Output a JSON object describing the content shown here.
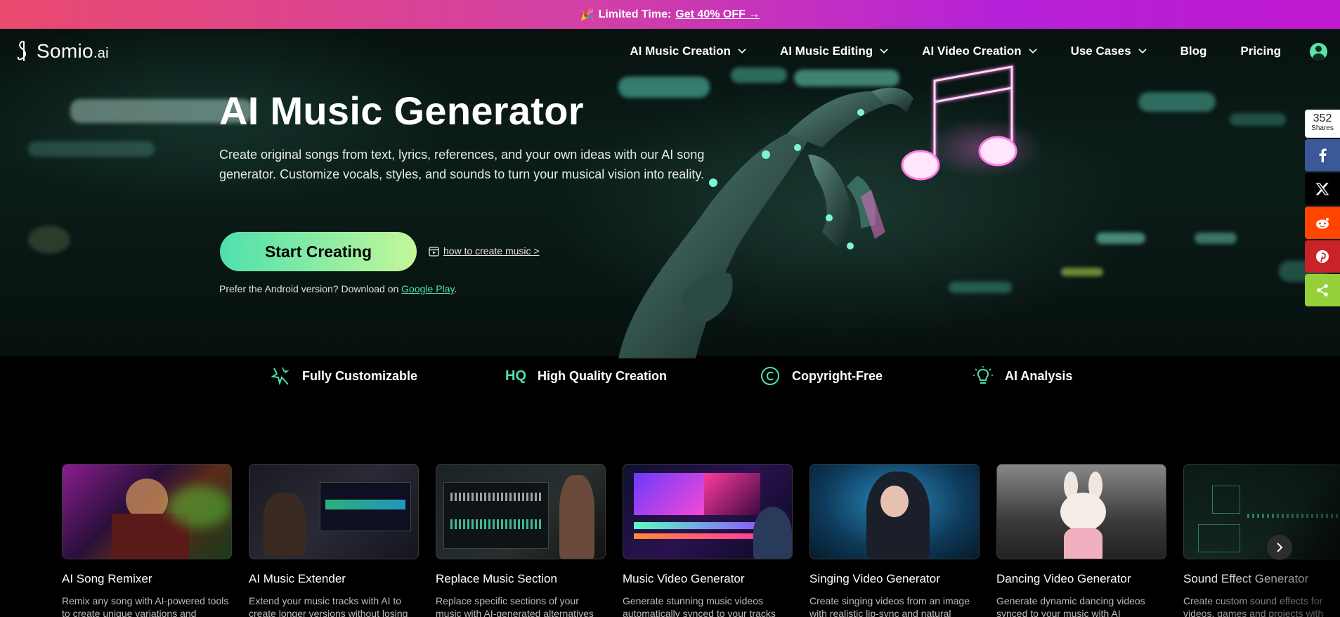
{
  "promo": {
    "prefix": "Limited Time:",
    "link": "Get 40% OFF →"
  },
  "brand": {
    "name": "Somio",
    "suffix": ".ai"
  },
  "nav": {
    "items": [
      {
        "label": "AI Music Creation",
        "has_dropdown": true
      },
      {
        "label": "AI Music Editing",
        "has_dropdown": true
      },
      {
        "label": "AI Video Creation",
        "has_dropdown": true
      },
      {
        "label": "Use Cases",
        "has_dropdown": true
      },
      {
        "label": "Blog",
        "has_dropdown": false
      },
      {
        "label": "Pricing",
        "has_dropdown": false
      }
    ],
    "avatar_icon": "user-avatar-icon"
  },
  "hero": {
    "title": "AI Music Generator",
    "description": "Create original songs from text, lyrics, references, and your own ideas with our AI song generator. Customize vocals, styles, and sounds to turn your musical vision into reality.",
    "cta_label": "Start Creating",
    "howto_label": "how to create music >",
    "android_prefix": "Prefer the Android version? Download on ",
    "android_link": "Google Play",
    "android_suffix": "."
  },
  "features": [
    {
      "label": "Fully Customizable",
      "icon": "magic-wand-icon"
    },
    {
      "label": "High Quality Creation",
      "icon": "hq-icon",
      "icon_text": "HQ"
    },
    {
      "label": "Copyright-Free",
      "icon": "copyright-icon"
    },
    {
      "label": "AI Analysis",
      "icon": "lightbulb-icon"
    }
  ],
  "cards": [
    {
      "title": "AI Song Remixer",
      "desc": "Remix any song with AI-powered tools to create unique variations and"
    },
    {
      "title": "AI Music Extender",
      "desc": "Extend your music tracks with AI to create longer versions without losing"
    },
    {
      "title": "Replace Music Section",
      "desc": "Replace specific sections of your music with AI-generated alternatives"
    },
    {
      "title": "Music Video Generator",
      "desc": "Generate stunning music videos automatically synced to your tracks"
    },
    {
      "title": "Singing Video Generator",
      "desc": "Create singing videos from an image with realistic lip-sync and natural"
    },
    {
      "title": "Dancing Video Generator",
      "desc": "Generate dynamic dancing videos synced to your music with AI"
    },
    {
      "title": "Sound Effect Generator",
      "desc": "Create custom sound effects for videos, games and projects with"
    }
  ],
  "share": {
    "count": "352",
    "label": "Shares",
    "buttons": [
      {
        "network": "facebook",
        "color": "#3b5998"
      },
      {
        "network": "x",
        "color": "#000000"
      },
      {
        "network": "reddit",
        "color": "#ff4500"
      },
      {
        "network": "pinterest",
        "color": "#c92228"
      },
      {
        "network": "sharethis",
        "color": "#95d03a"
      }
    ]
  },
  "colors": {
    "accent": "#4ee0ad",
    "cta_gradient_end": "#c4f79a",
    "promo_gradient_start": "#e94a6f",
    "promo_gradient_end": "#c01ad0"
  }
}
